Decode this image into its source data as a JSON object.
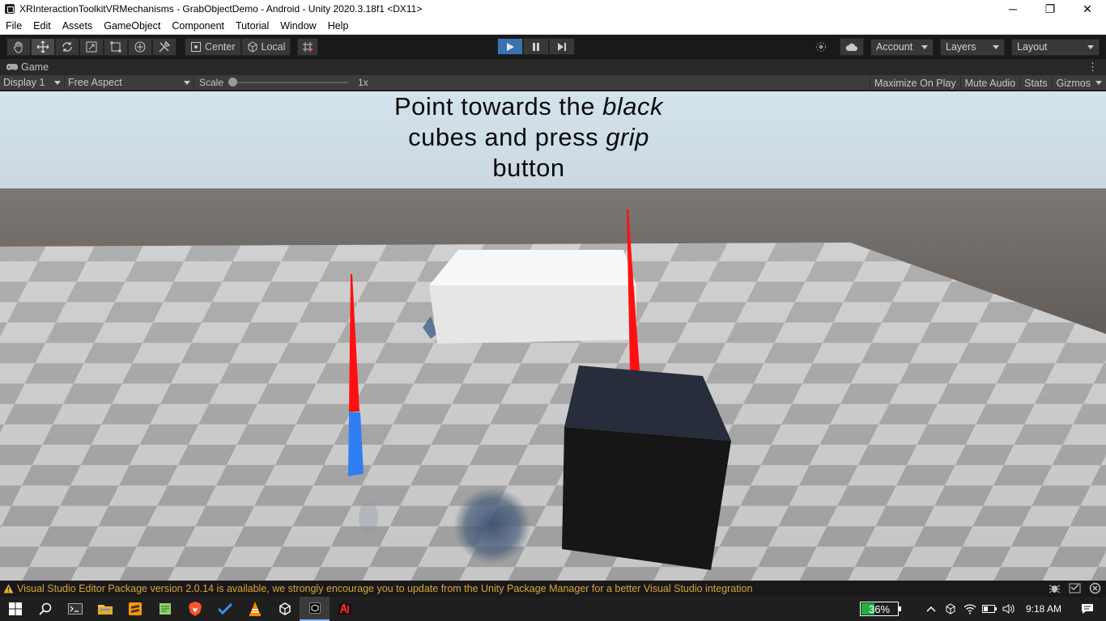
{
  "window": {
    "title": "XRInteractionToolkitVRMechanisms - GrabObjectDemo - Android - Unity 2020.3.18f1 <DX11>",
    "minimize": "─",
    "maximize": "❐",
    "close": "✕"
  },
  "menu": [
    "File",
    "Edit",
    "Assets",
    "GameObject",
    "Component",
    "Tutorial",
    "Window",
    "Help"
  ],
  "toolbar": {
    "pivot_label": "Center",
    "space_label": "Local",
    "account_label": "Account",
    "layers_label": "Layers",
    "layout_label": "Layout",
    "play_state": "playing"
  },
  "game_tab": {
    "label": "Game",
    "display": "Display 1",
    "aspect": "Free Aspect",
    "scale_label": "Scale",
    "scale_value": "1x",
    "scale_fraction": 0.0,
    "buttons": [
      "Maximize On Play",
      "Mute Audio",
      "Stats",
      "Gizmos"
    ]
  },
  "scene": {
    "instruction_line1_a": "Point towards the ",
    "instruction_line1_b": "black",
    "instruction_line2_a": "cubes and press ",
    "instruction_line2_b": "grip",
    "instruction_line3": "button"
  },
  "status": {
    "message": "Visual Studio Editor Package version 2.0.14 is available, we strongly encourage you to update from the Unity Package Manager for a better Visual Studio integration"
  },
  "taskbar": {
    "battery": "36%",
    "battery_level": 0.36,
    "clock": "9:18 AM"
  },
  "colors": {
    "play_active": "#3a72b0",
    "status_warning": "#d7a636",
    "battery_fill": "#1fb141"
  }
}
